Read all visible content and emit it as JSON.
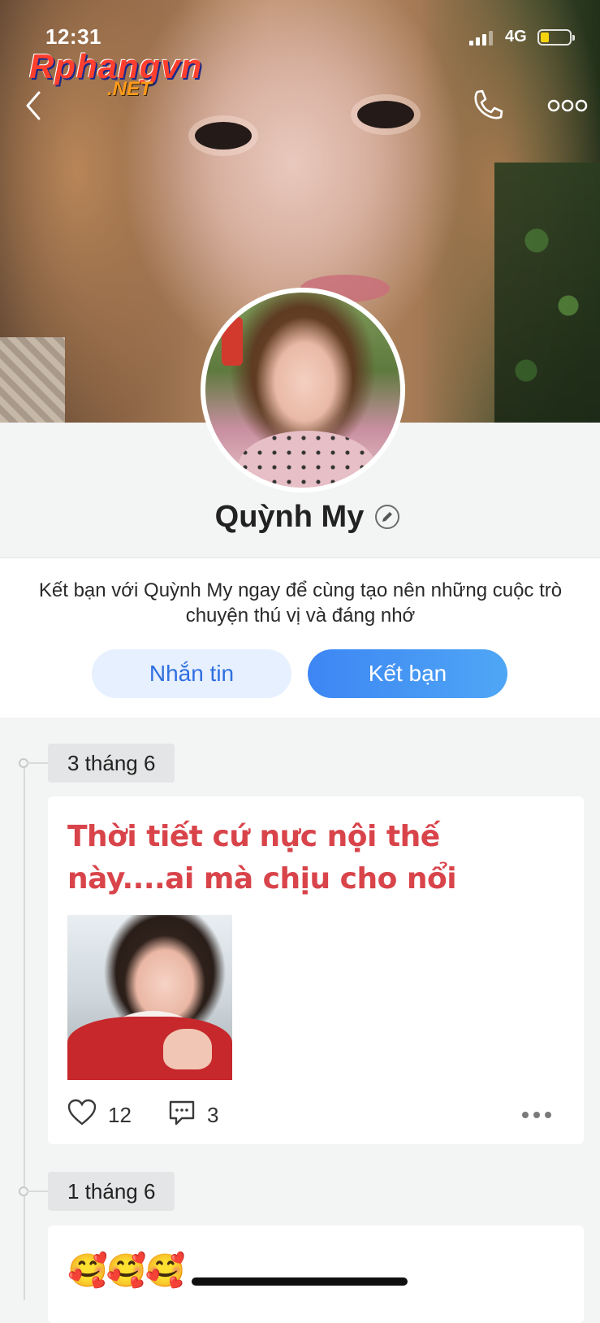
{
  "status_bar": {
    "time": "12:31",
    "network": "4G",
    "battery_color": "#f5d40f"
  },
  "watermark": {
    "line1": "Rphangvn",
    "line2": ".NET"
  },
  "nav": {
    "back_icon": "chevron-left-icon",
    "call_icon": "phone-icon",
    "more_icon": "more-horizontal-icon"
  },
  "profile": {
    "name": "Quỳnh My",
    "edit_icon": "pencil-icon"
  },
  "friend_prompt": {
    "message": "Kết bạn với Quỳnh My ngay để cùng tạo nên những cuộc trò chuyện thú vị và đáng nhớ",
    "message_button": "Nhắn tin",
    "add_friend_button": "Kết bạn",
    "accent": "#3d86f4"
  },
  "timeline": [
    {
      "date": "3 tháng 6",
      "text": "Thời tiết cứ nực nội thế này....ai mà chịu cho nổi",
      "text_color": "#d8444a",
      "likes": "12",
      "comments": "3"
    },
    {
      "date": "1 tháng 6",
      "text": "🥰🥰🥰"
    }
  ]
}
